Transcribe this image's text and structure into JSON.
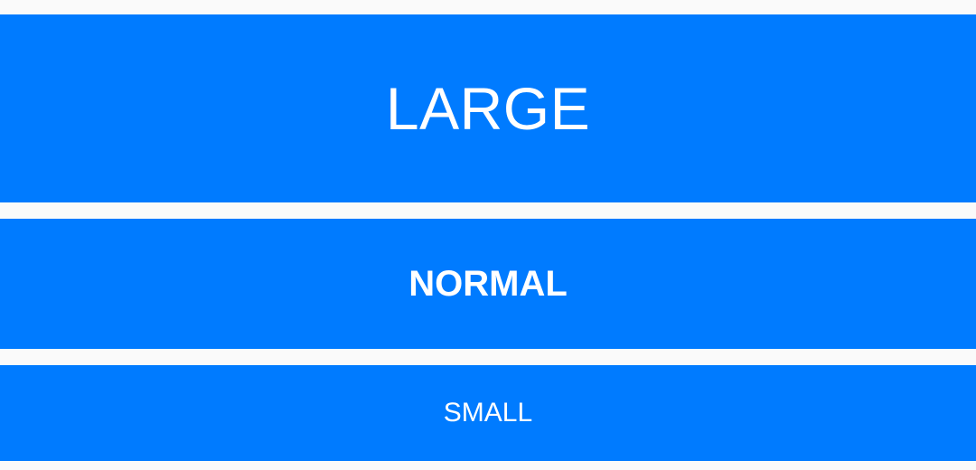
{
  "colors": {
    "background": "#fafafa",
    "button": "#007bff",
    "button_text": "#ffffff"
  },
  "buttons": {
    "large": {
      "label": "LARGE"
    },
    "normal": {
      "label": "NORMAL"
    },
    "small": {
      "label": "SMALL"
    }
  }
}
